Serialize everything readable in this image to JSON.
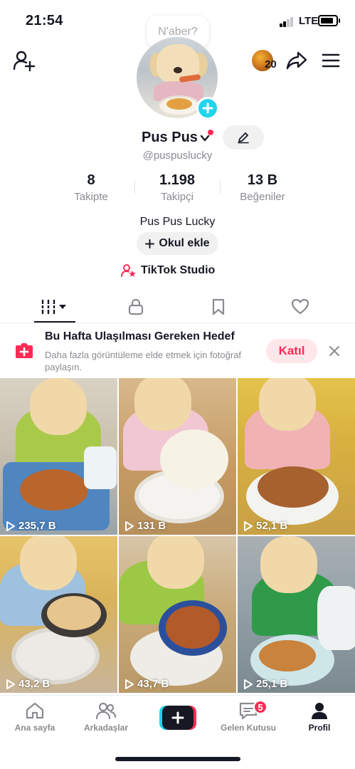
{
  "status_bar": {
    "time": "21:54",
    "network": "LTE"
  },
  "header": {
    "story_count": "20",
    "note_placeholder": "N'aber?"
  },
  "profile": {
    "display_name": "Pus Pus",
    "username": "@puspuslucky",
    "bio": "Pus Pus Lucky",
    "school_button": "Okul ekle",
    "studio_label": "TikTok Studio"
  },
  "stats": [
    {
      "value": "8",
      "label": "Takipte"
    },
    {
      "value": "1.198",
      "label": "Takipçi"
    },
    {
      "value": "13 B",
      "label": "Beğeniler"
    }
  ],
  "tabs": [
    {
      "name": "videos",
      "icon": "grid-icon"
    },
    {
      "name": "private",
      "icon": "lock-icon"
    },
    {
      "name": "saved",
      "icon": "bookmark-icon"
    },
    {
      "name": "liked",
      "icon": "heart-icon"
    }
  ],
  "banner": {
    "title": "Bu Hafta Ulaşılması Gereken Hedef",
    "description": "Daha fazla görüntüleme elde etmek için fotoğraf paylaşın.",
    "join_label": "Katıl"
  },
  "videos": [
    {
      "views": "235,7 B"
    },
    {
      "views": "131 B"
    },
    {
      "views": "52,1 B"
    },
    {
      "views": "43,2 B"
    },
    {
      "views": "43,7 B"
    },
    {
      "views": "25,1 B"
    }
  ],
  "bottom_nav": {
    "home": "Ana sayfa",
    "friends": "Arkadaşlar",
    "inbox": "Gelen Kutusu",
    "inbox_badge": "5",
    "profile": "Profil"
  },
  "colors": {
    "accent": "#fe2c55",
    "cyan": "#20d5ec",
    "text": "#161823",
    "secondary": "#8a8b91"
  }
}
